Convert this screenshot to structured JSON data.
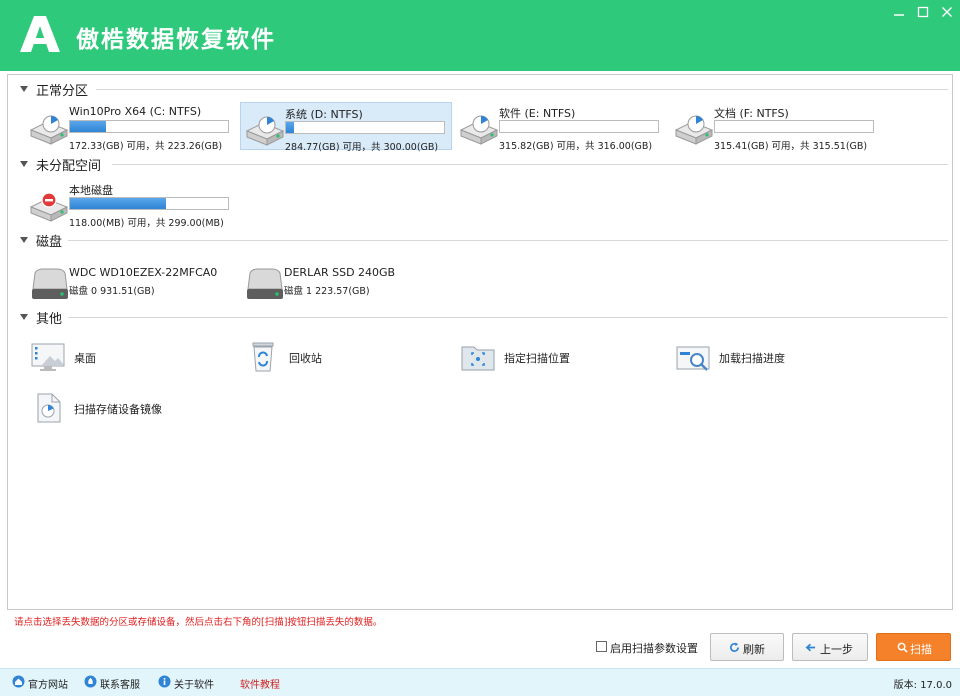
{
  "app": {
    "title": "傲梏数据恢复软件",
    "logo_letter": "A",
    "brand_color": "#2fc97c",
    "window_controls": [
      "minimize-icon",
      "maximize-icon",
      "close-icon"
    ]
  },
  "sections": {
    "partitions": "正常分区",
    "unallocated": "未分配空间",
    "disks": "磁盘",
    "others": "其他"
  },
  "partitions": [
    {
      "name": "Win10Pro X64 (C: NTFS)",
      "info": "172.33(GB) 可用，共 223.26(GB)",
      "used_fraction": 0.23,
      "selected": false
    },
    {
      "name": "系统 (D: NTFS)",
      "info": "284.77(GB) 可用，共 300.00(GB)",
      "used_fraction": 0.05,
      "selected": true
    },
    {
      "name": "软件 (E: NTFS)",
      "info": "315.82(GB) 可用，共 316.00(GB)",
      "used_fraction": 0.0,
      "selected": false
    },
    {
      "name": "文档 (F: NTFS)",
      "info": "315.41(GB) 可用，共 315.51(GB)",
      "used_fraction": 0.0,
      "selected": false
    }
  ],
  "unallocated": [
    {
      "name": "本地磁盘",
      "info": "118.00(MB) 可用，共 299.00(MB)",
      "used_fraction": 0.61
    }
  ],
  "disks": [
    {
      "name": "WDC WD10EZEX-22MFCA0",
      "info": "磁盘 0    931.51(GB)"
    },
    {
      "name": "DERLAR SSD 240GB",
      "info": "磁盘 1    223.57(GB)"
    }
  ],
  "others": [
    {
      "label": "桌面",
      "icon": "desktop-icon"
    },
    {
      "label": "回收站",
      "icon": "recycle-bin-icon"
    },
    {
      "label": "指定扫描位置",
      "icon": "folder-scan-icon"
    },
    {
      "label": "加载扫描进度",
      "icon": "load-progress-icon"
    },
    {
      "label": "扫描存储设备镜像",
      "icon": "disk-image-icon"
    }
  ],
  "hint": "请点击选择丢失数据的分区或存储设备，然后点击右下角的[扫描]按钮扫描丢失的数据。",
  "options": {
    "scan_params_label": "启用扫描参数设置",
    "scan_params_checked": false
  },
  "buttons": {
    "refresh": "刷新",
    "back": "上一步",
    "scan": "扫描"
  },
  "status": {
    "website": "官方网站",
    "support": "联系客服",
    "about": "关于软件",
    "tutorial": "软件教程",
    "version": "版本: 17.0.0"
  }
}
